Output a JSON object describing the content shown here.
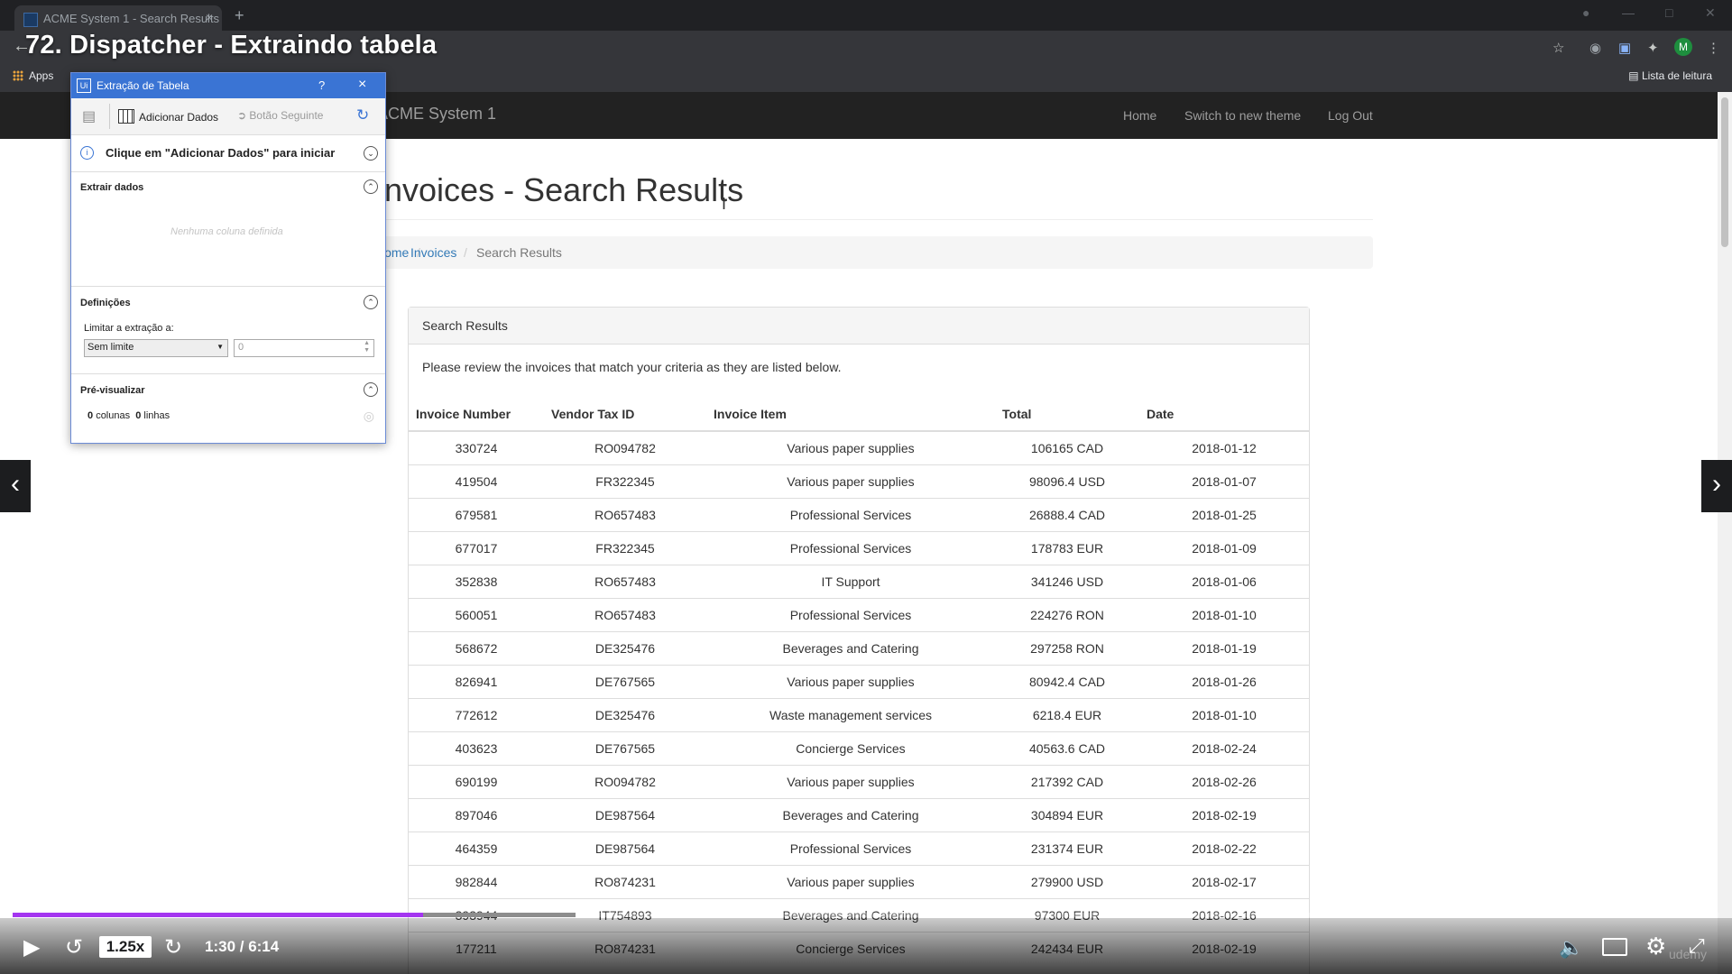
{
  "browser": {
    "tab_title": "ACME System 1 - Search Results",
    "tab_close": "×",
    "new_tab": "+",
    "apps_label": "Apps",
    "reading_list": "Lista de leitura",
    "avatar_letter": "M"
  },
  "video": {
    "title": "72. Dispatcher - Extraindo tabela",
    "speed": "1.25x",
    "time": "1:30 / 6:14",
    "progress_fraction": 0.2406,
    "buffered_fraction": 0.33,
    "watermark": "udemy",
    "accent_color": "#a435f0"
  },
  "site": {
    "brand": "ACME System 1",
    "nav": [
      "Home",
      "Switch to new theme",
      "Log Out"
    ],
    "page_title": "Invoices - Search Results",
    "breadcrumb": [
      "Home",
      "Invoices",
      "Search Results"
    ],
    "panel_heading": "Search Results",
    "panel_text": "Please review the invoices that match your criteria as they are listed below.",
    "columns": [
      "Invoice Number",
      "Vendor Tax ID",
      "Invoice Item",
      "Total",
      "Date"
    ],
    "rows": [
      [
        "330724",
        "RO094782",
        "Various paper supplies",
        "106165 CAD",
        "2018-01-12"
      ],
      [
        "419504",
        "FR322345",
        "Various paper supplies",
        "98096.4 USD",
        "2018-01-07"
      ],
      [
        "679581",
        "RO657483",
        "Professional Services",
        "26888.4 CAD",
        "2018-01-25"
      ],
      [
        "677017",
        "FR322345",
        "Professional Services",
        "178783 EUR",
        "2018-01-09"
      ],
      [
        "352838",
        "RO657483",
        "IT Support",
        "341246 USD",
        "2018-01-06"
      ],
      [
        "560051",
        "RO657483",
        "Professional Services",
        "224276 RON",
        "2018-01-10"
      ],
      [
        "568672",
        "DE325476",
        "Beverages and Catering",
        "297258 RON",
        "2018-01-19"
      ],
      [
        "826941",
        "DE767565",
        "Various paper supplies",
        "80942.4 CAD",
        "2018-01-26"
      ],
      [
        "772612",
        "DE325476",
        "Waste management services",
        "6218.4 EUR",
        "2018-01-10"
      ],
      [
        "403623",
        "DE767565",
        "Concierge Services",
        "40563.6 CAD",
        "2018-02-24"
      ],
      [
        "690199",
        "RO094782",
        "Various paper supplies",
        "217392 CAD",
        "2018-02-26"
      ],
      [
        "897046",
        "DE987564",
        "Beverages and Catering",
        "304894 EUR",
        "2018-02-19"
      ],
      [
        "464359",
        "DE987564",
        "Professional Services",
        "231374 EUR",
        "2018-02-22"
      ],
      [
        "982844",
        "RO874231",
        "Various paper supplies",
        "279900 USD",
        "2018-02-17"
      ],
      [
        "393944",
        "IT754893",
        "Beverages and Catering",
        "97300 EUR",
        "2018-02-16"
      ],
      [
        "177211",
        "RO874231",
        "Concierge Services",
        "242434 EUR",
        "2018-02-19"
      ]
    ]
  },
  "dialog": {
    "title": "Extração de Tabela",
    "help": "?",
    "close": "×",
    "add_data": "Adicionar Dados",
    "next_button": "Botão Seguinte",
    "hint": "Clique em \"Adicionar Dados\" para iniciar",
    "extract_section": "Extrair dados",
    "no_columns": "Nenhuma coluna definida",
    "settings_section": "Definições",
    "limit_label": "Limitar a extração a:",
    "limit_value": "Sem limite",
    "limit_count": "0",
    "preview_section": "Pré-visualizar",
    "preview_columns_count": "0",
    "preview_columns_label": "colunas",
    "preview_rows_count": "0",
    "preview_rows_label": "linhas"
  }
}
